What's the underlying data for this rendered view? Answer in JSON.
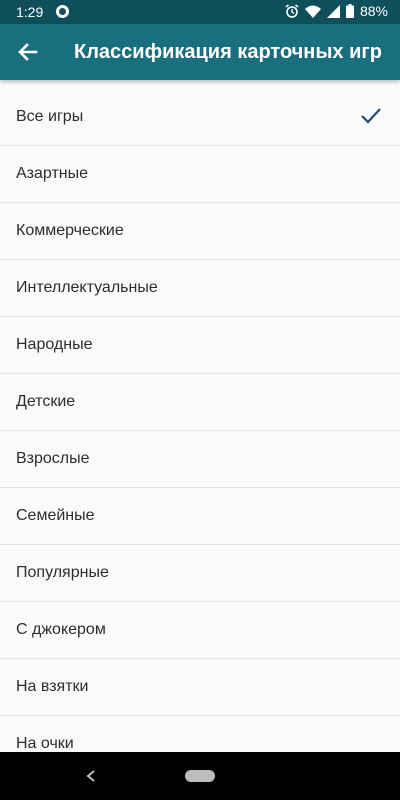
{
  "status_bar": {
    "time": "1:29",
    "battery_percent": "88%",
    "icons": [
      "app-notification-icon",
      "alarm-icon",
      "wifi-icon",
      "signal-icon",
      "battery-icon"
    ]
  },
  "app_bar": {
    "title": "Классификация карточных игр",
    "back_icon": "arrow-back-icon",
    "background_color": "#1a6f7f"
  },
  "list": {
    "selected_index": 0,
    "items": [
      {
        "label": "Все игры",
        "selected": true
      },
      {
        "label": "Азартные",
        "selected": false
      },
      {
        "label": "Коммерческие",
        "selected": false
      },
      {
        "label": "Интеллектуальные",
        "selected": false
      },
      {
        "label": "Народные",
        "selected": false
      },
      {
        "label": "Детские",
        "selected": false
      },
      {
        "label": "Взрослые",
        "selected": false
      },
      {
        "label": "Семейные",
        "selected": false
      },
      {
        "label": "Популярные",
        "selected": false
      },
      {
        "label": "С джокером",
        "selected": false
      },
      {
        "label": "На взятки",
        "selected": false
      },
      {
        "label": "На очки",
        "selected": false
      }
    ]
  },
  "nav_bar": {
    "icons": [
      "back-triangle-icon",
      "home-pill-icon"
    ]
  }
}
